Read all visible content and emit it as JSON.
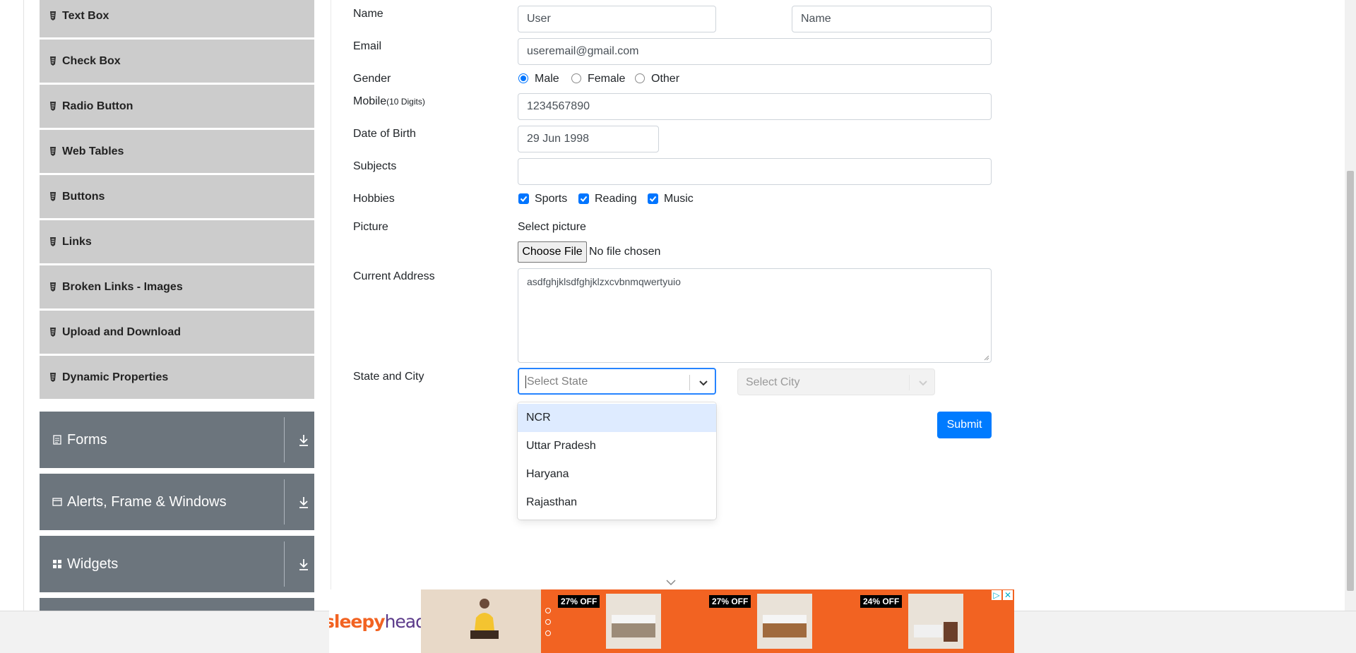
{
  "sidebar": {
    "items": [
      {
        "label": "Text Box"
      },
      {
        "label": "Check Box"
      },
      {
        "label": "Radio Button"
      },
      {
        "label": "Web Tables"
      },
      {
        "label": "Buttons"
      },
      {
        "label": "Links"
      },
      {
        "label": "Broken Links - Images"
      },
      {
        "label": "Upload and Download"
      },
      {
        "label": "Dynamic Properties"
      }
    ],
    "groups": [
      {
        "label": "Forms",
        "icon": "document-icon"
      },
      {
        "label": "Alerts, Frame & Windows",
        "icon": "window-icon"
      },
      {
        "label": "Widgets",
        "icon": "grid-icon"
      }
    ]
  },
  "form": {
    "name_label": "Name",
    "first_name_value": "User",
    "last_name_value": "Name",
    "email_label": "Email",
    "email_value": "useremail@gmail.com",
    "gender_label": "Gender",
    "gender_options": [
      "Male",
      "Female",
      "Other"
    ],
    "gender_selected": "Male",
    "mobile_label": "Mobile",
    "mobile_hint": "(10 Digits)",
    "mobile_value": "1234567890",
    "dob_label": "Date of Birth",
    "dob_value": "29 Jun 1998",
    "subjects_label": "Subjects",
    "subjects_value": "",
    "hobbies_label": "Hobbies",
    "hobbies": [
      "Sports",
      "Reading",
      "Music"
    ],
    "picture_label": "Picture",
    "picture_prompt": "Select picture",
    "choose_file_label": "Choose File",
    "no_file_text": "No file chosen",
    "address_label": "Current Address",
    "address_value": "asdfghjklsdfghjklzxcvbnmqwertyuio",
    "state_city_label": "State and City",
    "state_placeholder": "Select State",
    "city_placeholder": "Select City",
    "state_options": [
      "NCR",
      "Uttar Pradesh",
      "Haryana",
      "Rajasthan"
    ],
    "highlighted_option": "NCR",
    "submit_label": "Submit"
  },
  "ad": {
    "logo_main": "sleepy",
    "logo_suffix": "head",
    "offers": [
      "27% OFF",
      "27% OFF",
      "24% OFF"
    ],
    "accent_color": "#f26322"
  },
  "colors": {
    "primary": "#007bff",
    "sidebar_item_bg": "#cccccc",
    "sidebar_group_bg": "#6c757d"
  }
}
